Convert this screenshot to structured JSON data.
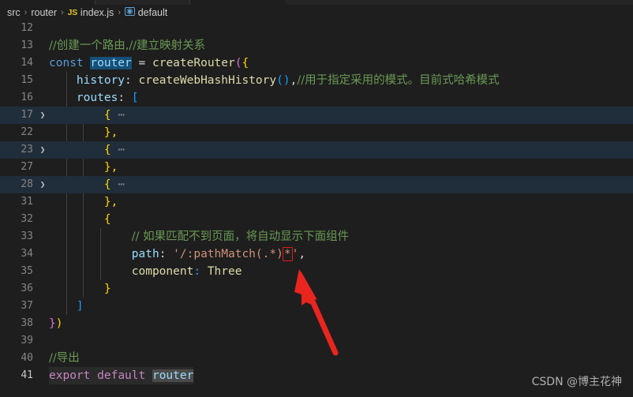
{
  "window": {
    "theme": "vscode-dark",
    "background": "#1e1e1e"
  },
  "tabs": [
    {
      "name": "tab-1"
    },
    {
      "name": "tab-2"
    }
  ],
  "breadcrumb": {
    "name": "breadcrumb",
    "items": [
      {
        "label": "src",
        "icon": null
      },
      {
        "label": "router",
        "icon": null
      },
      {
        "label": "index.js",
        "icon": "js-file-icon"
      },
      {
        "label": "default",
        "icon": "symbol-default-icon"
      }
    ],
    "separator": "›",
    "js_icon_text": "JS",
    "symbol_icon_text": "◉"
  },
  "editor": {
    "name": "code-editor",
    "language": "javascript",
    "active_line": 41,
    "colors": {
      "background": "#1e1e1e",
      "line_number": "#858585",
      "active_line_number": "#c6c6c6",
      "comment": "#6a9955",
      "keyword": "#569cd6",
      "keyword_control": "#c586c0",
      "function": "#dcdcaa",
      "variable": "#9cdcfe",
      "string": "#ce9178",
      "folded_row": "#202d3a",
      "selection": "#164f78",
      "occurrence": "#4a4a4a",
      "annotation_red": "#e01b1b"
    },
    "lines": [
      {
        "num": "12",
        "folded": false,
        "text": ""
      },
      {
        "num": "13",
        "folded": false,
        "text": "//创建一个路由,//建立映射关系"
      },
      {
        "num": "14",
        "folded": false,
        "text": "const router = createRouter({"
      },
      {
        "num": "15",
        "folded": false,
        "text": "    history: createWebHashHistory(),//用于指定采用的模式。目前式哈希模式"
      },
      {
        "num": "16",
        "folded": false,
        "text": "    routes: ["
      },
      {
        "num": "17",
        "folded": true,
        "text": "        { ⋯"
      },
      {
        "num": "22",
        "folded": false,
        "text": "        },"
      },
      {
        "num": "23",
        "folded": true,
        "text": "        { ⋯"
      },
      {
        "num": "27",
        "folded": false,
        "text": "        },"
      },
      {
        "num": "28",
        "folded": true,
        "text": "        { ⋯"
      },
      {
        "num": "31",
        "folded": false,
        "text": "        },"
      },
      {
        "num": "32",
        "folded": false,
        "text": "        {"
      },
      {
        "num": "33",
        "folded": false,
        "text": "            // 如果匹配不到页面，将自动显示下面组件"
      },
      {
        "num": "34",
        "folded": false,
        "text": "            path: '/:pathMatch(.*)*',"
      },
      {
        "num": "35",
        "folded": false,
        "text": "            component: Three"
      },
      {
        "num": "36",
        "folded": false,
        "text": "        }"
      },
      {
        "num": "37",
        "folded": false,
        "text": "    ]"
      },
      {
        "num": "38",
        "folded": false,
        "text": "})"
      },
      {
        "num": "39",
        "folded": false,
        "text": ""
      },
      {
        "num": "40",
        "folded": false,
        "text": "//导出"
      },
      {
        "num": "41",
        "folded": false,
        "text": "export default router"
      }
    ],
    "tokens": {
      "line13_comment": "//创建一个路由,//建立映射关系",
      "line14_const": "const",
      "line14_router": "router",
      "line14_eq": " = ",
      "line14_fn": "createRouter",
      "line14_open": "(",
      "line14_brace": "{",
      "line15_prop": "history",
      "line15_colon": ": ",
      "line15_fn": "createWebHashHistory",
      "line15_parens": "()",
      "line15_comma": ",",
      "line15_comment": "//用于指定采用的模式。目前式哈希模式",
      "line16_prop": "routes",
      "line16_colon": ": ",
      "line16_bracket": "[",
      "fold_brace": "{",
      "fold_ellipsis": "⋯",
      "close_brace_comma": "},",
      "open_brace": "{",
      "line33_comment": "// 如果匹配不到页面，将自动显示下面组件",
      "line34_prop": "path",
      "line34_colon": ": ",
      "line34_str_a": "'/:pathMatch(.*)",
      "line34_star": "*",
      "line34_str_b": "'",
      "line34_comma": ",",
      "line35_prop": "component",
      "line35_colon": ": ",
      "line35_val": "Three",
      "line36_close": "}",
      "line37_bracket": "]",
      "line38_close_brace": "}",
      "line38_close_paren": ")",
      "line40_comment": "//导出",
      "line41_export": "export",
      "line41_default": "default",
      "line41_router": "router"
    }
  },
  "annotation": {
    "name": "red-arrow",
    "color": "#e8251f",
    "points_to": "asterisk-in-path-string"
  },
  "watermark": {
    "text": "CSDN @博主花神"
  }
}
